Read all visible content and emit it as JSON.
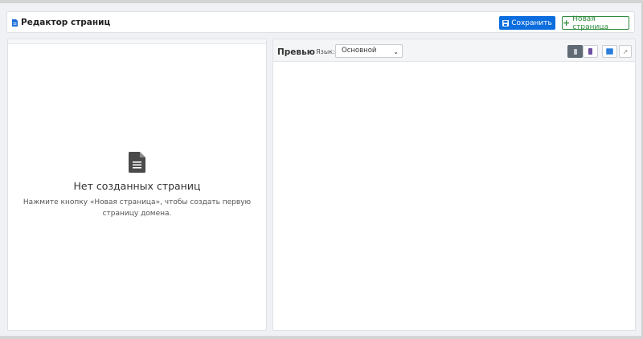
{
  "header": {
    "title": "Редактор страниц",
    "save_label": "Сохранить",
    "new_page_label": "Новая страница"
  },
  "left": {
    "empty_title": "Нет созданных страниц",
    "empty_text": "Нажмите кнопку «Новая страница», чтобы создать первую страницу домена."
  },
  "preview": {
    "title": "Превью",
    "lang_label": "Язык:",
    "lang_value": "Основной"
  },
  "colors": {
    "primary": "#0b6dde",
    "success": "#2e8b3c",
    "icon_blue": "#1e6fd9"
  },
  "icons": [
    "document-icon",
    "save-icon",
    "plus-icon",
    "mobile-icon",
    "tablet-icon",
    "desktop-icon",
    "external-link-icon"
  ]
}
